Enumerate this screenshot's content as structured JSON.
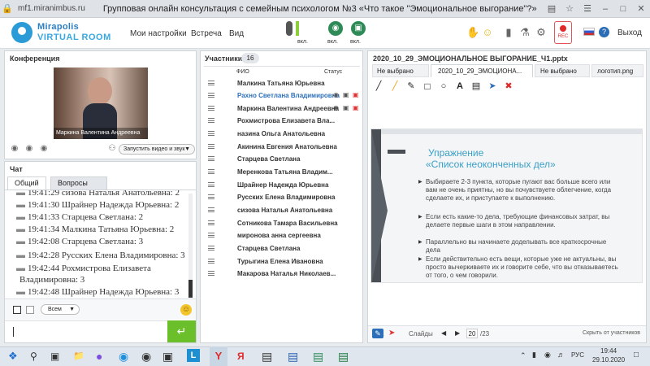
{
  "browser": {
    "url": "mf1.miranimbus.ru",
    "title": "Групповая онлайн консультация с семейным психологом №3 «Что такое \"Эмоциональное выгорание\"?»"
  },
  "app": {
    "logo_line1": "Mirapolis",
    "logo_line2": "VIRTUAL ROOM",
    "menu": [
      "Мои настройки",
      "Встреча",
      "Вид"
    ],
    "media_labels": [
      "вкл.",
      "вкл.",
      "вкл."
    ],
    "rec_label": "REC",
    "exit": "Выход"
  },
  "conference": {
    "title": "Конференция",
    "video_caption": "Маркина Валентина Андреевна",
    "start_media": "Запустить видео и звук"
  },
  "chat": {
    "title": "Чат",
    "tabs": [
      "Общий",
      "Вопросы"
    ],
    "messages": [
      "19:41:29 сизова Наталья Анатольевна: 2",
      "19:41:30 Шрайнер Надежда Юрьевна: 2",
      "19:41:33 Старцева Светлана: 2",
      "19:41:34 Малкина Татьяна Юрьевна: 2",
      "19:42:08 Старцева Светлана: 3",
      "19:42:28 Русских Елена Владимировна: 3",
      "19:42:44 Рохмистрова Елизавета",
      "Владимировна: 3",
      "19:42:48 Шрайнер Надежда Юрьевна: 3"
    ],
    "recipient": "Всем"
  },
  "participants": {
    "title": "Участники",
    "count": "16",
    "col_name": "ФИО",
    "col_status": "Статус",
    "list": [
      "Малкина Татьяна Юрьевна",
      "Рахно Светлана Владимировна",
      "Маркина Валентина Андреевна",
      "Рохмистрова Елизавета Вла...",
      "назина Ольга Анатольевна",
      "Акинина Евгения Анатольевна",
      "Старцева Светлана",
      "Меренкова Татьяна Владим...",
      "Шрайнер Надежда Юрьевна",
      "Русских Елена Владимировна",
      "сизова Наталья Анатольевна",
      "Сотникова Тамара Васильевна",
      "миронова анна сергеевна",
      "Старцева Светлана",
      "Турыгина Елена Ивановна",
      "Макарова Наталья Николаев..."
    ]
  },
  "presentation": {
    "title": "2020_10_29_ЭМОЦИОНАЛЬНОЕ ВЫГОРАНИЕ_Ч1.pptx",
    "tabs": [
      "Не выбрано",
      "2020_10_29_ЭМОЦИОНА...",
      "Не выбрано",
      "логотип.png"
    ],
    "slide_title1": "Упражнение",
    "slide_title2": "«Список неоконченных дел»",
    "bullets": [
      "Выбираете 2-3 пункта, которые пугают вас больше всего или вам не очень приятны, но вы почувствуете облегчение, когда сделаете их, и приступаете к выполнению.",
      "Если есть какие-то дела, требующие финансовых затрат, вы делаете первые шаги в этом направлении.",
      "Параллельно вы начинаете доделывать все краткосрочные дела",
      "Если действительно есть вещи, которые уже не актуальны, вы просто вычеркиваете их и говорите себе, что вы отказываетесь от того, о чем говорили."
    ],
    "slides_label": "Слайды",
    "page": "20",
    "total": "/23",
    "hide": "Скрыть от участников"
  },
  "taskbar": {
    "lang": "РУС",
    "time": "19:44",
    "date": "29.10.2020"
  },
  "colors": {
    "accent": "#2a9bd6",
    "green": "#2e8b57",
    "send": "#6bbf2a",
    "slide_title": "#3aa0c8"
  }
}
